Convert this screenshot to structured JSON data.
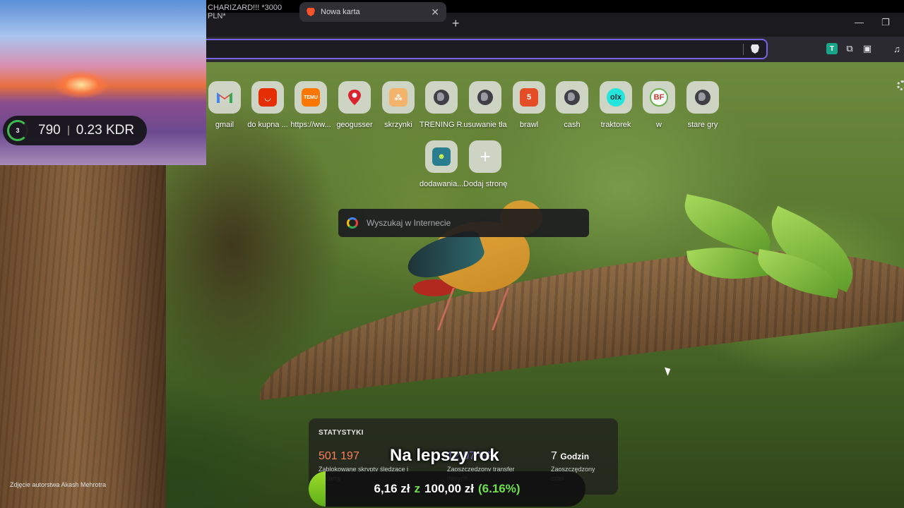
{
  "browser": {
    "tabs": [
      {
        "label": "CHARIZARD!!! *3000 PLN*",
        "active": false
      },
      {
        "label": "Nowa karta",
        "active": true
      }
    ],
    "new_tab_glyph": "+",
    "close_glyph": "✕",
    "window": {
      "minimize": "—",
      "restore": "❐"
    },
    "accent": "#7a62e8",
    "extensions": [
      "tab-extension-icon",
      "puzzle-icon",
      "screenshot-icon",
      "music-icon"
    ]
  },
  "ntp": {
    "tiles": [
      {
        "label": "gmail",
        "icon": "gmail-icon",
        "color": "#ffffff"
      },
      {
        "label": "do kupna ...",
        "icon": "aliexpress-icon",
        "color": "#e62e04"
      },
      {
        "label": "https://ww...",
        "icon": "temu-icon",
        "color": "#fb7701"
      },
      {
        "label": "geogusser",
        "icon": "map-pin-icon",
        "color": "#ffffff"
      },
      {
        "label": "skrzynki",
        "icon": "grid-icon",
        "color": "#f3b36a"
      },
      {
        "label": "TRENING R...",
        "icon": "globe-icon",
        "color": ""
      },
      {
        "label": "usuwanie tła",
        "icon": "globe-icon",
        "color": ""
      },
      {
        "label": "brawl",
        "icon": "html5-icon",
        "color": "#e44d26"
      },
      {
        "label": "cash",
        "icon": "globe-icon",
        "color": ""
      },
      {
        "label": "traktorek",
        "icon": "olx-icon",
        "color": "#23e5db"
      },
      {
        "label": "w",
        "icon": "bf-icon",
        "color": "#ffffff"
      },
      {
        "label": "stare gry",
        "icon": "globe-icon",
        "color": ""
      },
      {
        "label": "dodawania...",
        "icon": "duolingo-icon",
        "color": "#2a7d8f"
      },
      {
        "label": "Dodaj stronę",
        "icon": "plus-icon",
        "color": ""
      }
    ],
    "search_placeholder": "Wyszukaj w Internecie",
    "stats": {
      "title": "STATYSTYKI",
      "blocked_value": "501 197",
      "blocked_desc": "Zablokowane skrypty śledzące i reklamy",
      "bandwidth_value": "12,07 GB",
      "bandwidth_desc": "Zaoszczędzony transfer danych",
      "time_value": "7",
      "time_unit": "Godzin",
      "time_desc": "Zaoszczędzony czas"
    },
    "photo_credit": "Zdjęcie autorstwa Akash Mehrotra"
  },
  "webcam_hud": {
    "level": "3",
    "kills": "790",
    "kdr": "0.23 KDR"
  },
  "stream_overlay": {
    "title": "Na lepszy rok",
    "current": "6,16 zł",
    "separator": "z",
    "goal": "100,00 zł",
    "percent_label": "(6.16%)",
    "progress_fraction": 0.0616
  }
}
